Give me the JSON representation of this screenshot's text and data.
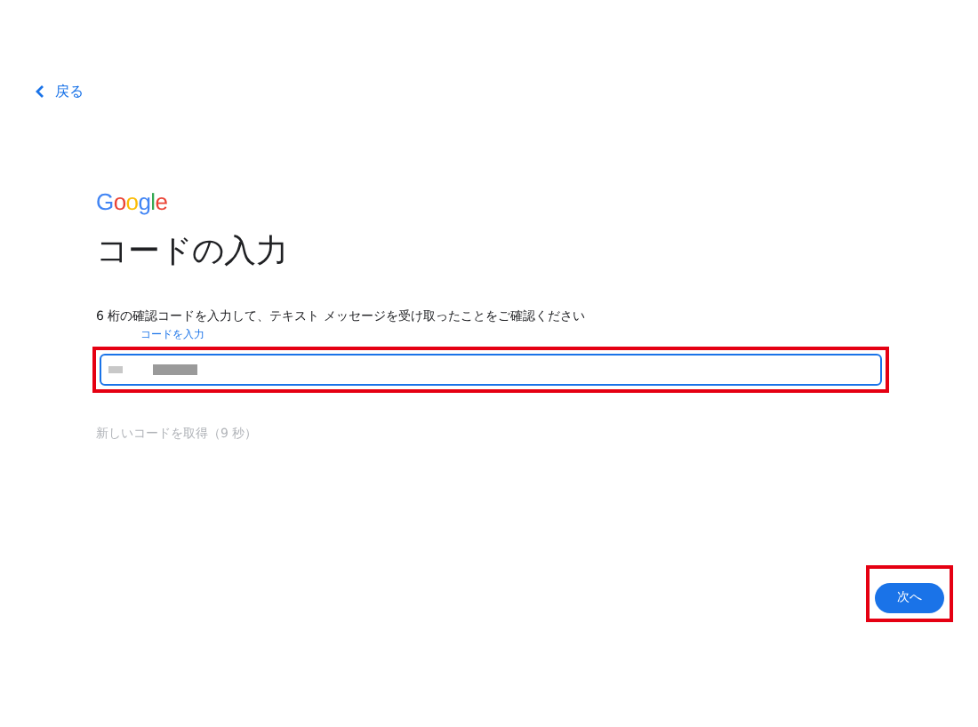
{
  "back_link": {
    "label": "戻る"
  },
  "logo": "Google",
  "title": "コードの入力",
  "instruction": "6 桁の確認コードを入力して、テキスト メッセージを受け取ったことをご確認ください",
  "code_field": {
    "label": "コードを入力",
    "focused": true,
    "highlighted": true
  },
  "resend_link": {
    "label": "新しいコードを取得（9 秒）",
    "disabled": true
  },
  "next_button": {
    "label": "次へ",
    "highlighted": true
  }
}
